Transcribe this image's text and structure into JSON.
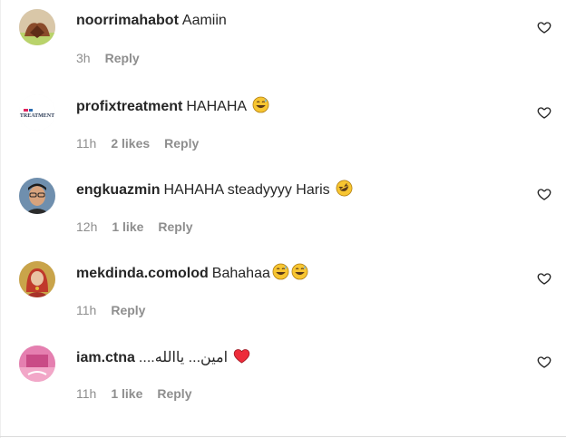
{
  "comments": [
    {
      "username": "noorrimahabot",
      "text": "Aamiin",
      "time": "3h",
      "likes": "",
      "reply": "Reply",
      "emojis": [],
      "avatar": "user-avatar"
    },
    {
      "username": "profixtreatment",
      "text": "HAHAHA",
      "time": "11h",
      "likes": "2 likes",
      "reply": "Reply",
      "emojis": [
        "grinning-sweat-emoji"
      ],
      "avatar": "brand-logo-avatar",
      "logo_text": "TREATMENT"
    },
    {
      "username": "engkuazmin",
      "text": "HAHAHA steadyyyy Haris",
      "time": "12h",
      "likes": "1 like",
      "reply": "Reply",
      "emojis": [
        "rolling-laughing-emoji"
      ],
      "avatar": "user-avatar"
    },
    {
      "username": "mekdinda.comolod",
      "text": "Bahahaa",
      "time": "11h",
      "likes": "",
      "reply": "Reply",
      "emojis": [
        "grinning-sweat-emoji",
        "grinning-sweat-emoji"
      ],
      "avatar": "user-avatar"
    },
    {
      "username": "iam.ctna",
      "text": "امين... ياالله....",
      "time": "11h",
      "likes": "1 like",
      "reply": "Reply",
      "emojis": [
        "red-heart-emoji"
      ],
      "avatar": "user-avatar"
    }
  ],
  "colors": {
    "text": "#262626",
    "muted": "#8e8e8e",
    "heart": "#ed2c3a",
    "emoji": "#f7c531"
  }
}
